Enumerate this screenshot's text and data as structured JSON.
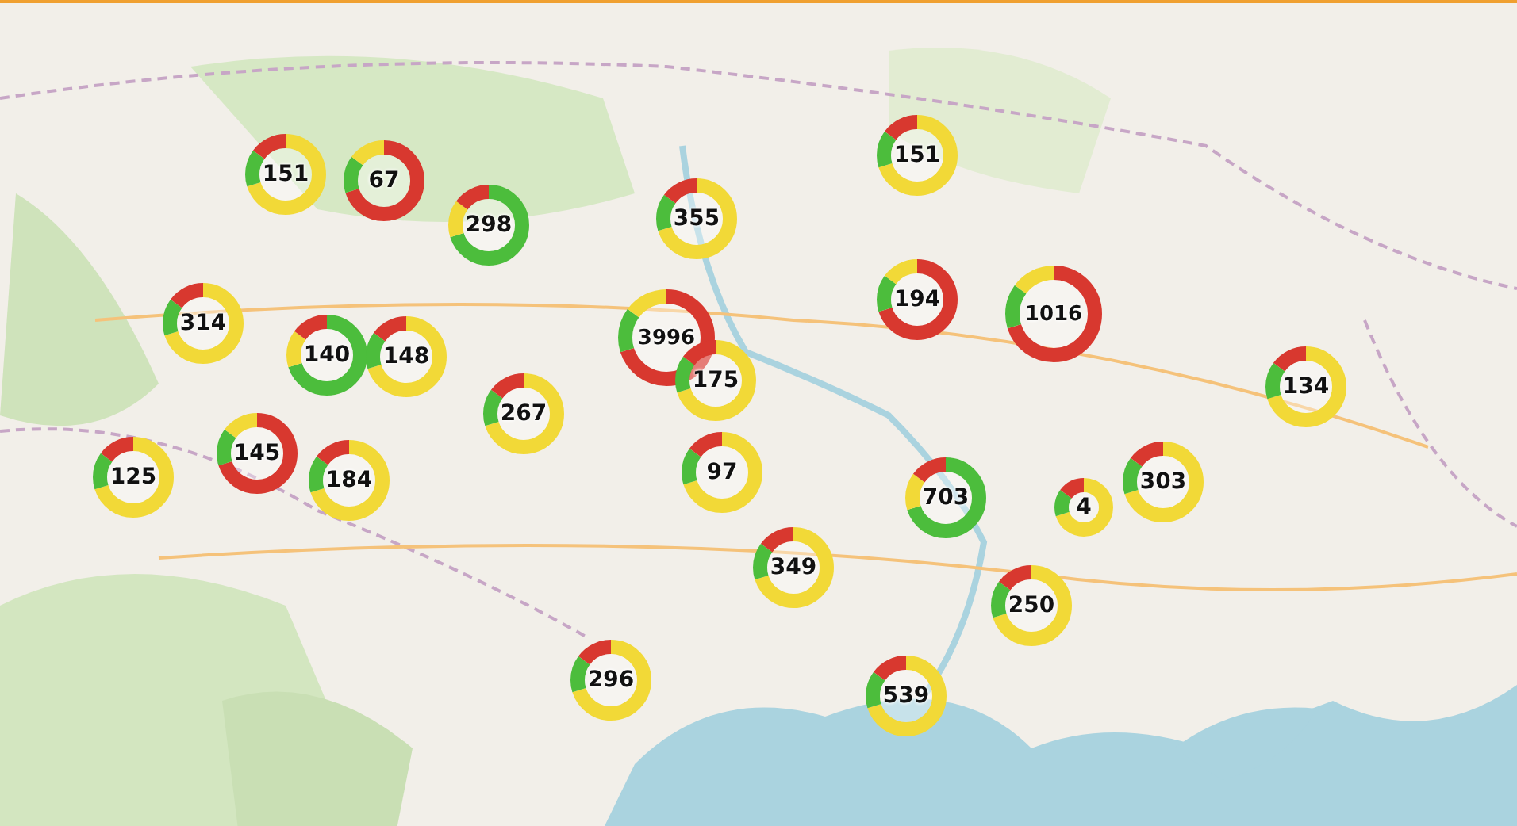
{
  "markers": [
    {
      "count": "151",
      "color": "#f2d937"
    },
    {
      "count": "67",
      "color": "#d8382f"
    },
    {
      "count": "298",
      "color": "#4cbd3c"
    },
    {
      "count": "355",
      "color": "#f2d937"
    },
    {
      "count": "151",
      "color": "#f2d937"
    },
    {
      "count": "314",
      "color": "#f2d937"
    },
    {
      "count": "140",
      "color": "#4cbd3c"
    },
    {
      "count": "148",
      "color": "#f2d937"
    },
    {
      "count": "3996",
      "color": "#d8382f"
    },
    {
      "count": "194",
      "color": "#d8382f"
    },
    {
      "count": "1016",
      "color": "#d8382f"
    },
    {
      "count": "134",
      "color": "#f2d937"
    },
    {
      "count": "175",
      "color": "#f2d937"
    },
    {
      "count": "267",
      "color": "#f2d937"
    },
    {
      "count": "125",
      "color": "#f2d937"
    },
    {
      "count": "145",
      "color": "#d8382f"
    },
    {
      "count": "184",
      "color": "#f2d937"
    },
    {
      "count": "97",
      "color": "#f2d937"
    },
    {
      "count": "703",
      "color": "#4cbd3c"
    },
    {
      "count": "4",
      "color": "#f2d937"
    },
    {
      "count": "303",
      "color": "#f2d937"
    },
    {
      "count": "349",
      "color": "#f2d937"
    },
    {
      "count": "250",
      "color": "#f2d937"
    },
    {
      "count": "296",
      "color": "#f2d937"
    },
    {
      "count": "539",
      "color": "#f2d937"
    }
  ]
}
